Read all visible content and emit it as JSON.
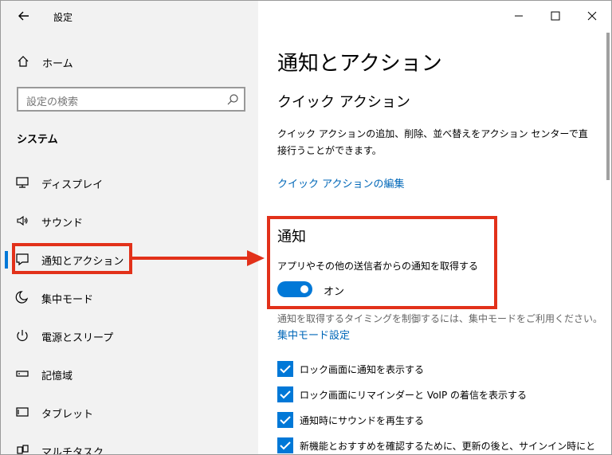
{
  "window": {
    "app_title": "設定",
    "back_icon": "back-arrow-icon",
    "controls": {
      "minimize": "—",
      "maximize": "☐",
      "close": "✕"
    }
  },
  "sidebar": {
    "home_label": "ホーム",
    "search_placeholder": "設定の検索",
    "section_label": "システム",
    "items": [
      {
        "label": "ディスプレイ",
        "icon": "monitor-icon"
      },
      {
        "label": "サウンド",
        "icon": "speaker-icon"
      },
      {
        "label": "通知とアクション",
        "icon": "notification-icon",
        "active": true
      },
      {
        "label": "集中モード",
        "icon": "moon-icon"
      },
      {
        "label": "電源とスリープ",
        "icon": "power-icon"
      },
      {
        "label": "記憶域",
        "icon": "storage-icon"
      },
      {
        "label": "タブレット",
        "icon": "tablet-icon"
      },
      {
        "label": "マルチタスク",
        "icon": "multitask-icon"
      }
    ]
  },
  "main": {
    "page_title": "通知とアクション",
    "quick_actions_title": "クイック アクション",
    "quick_actions_desc": "クイック アクションの追加、削除、並べ替えをアクション センターで直接行うことができます。",
    "quick_actions_link": "クイック アクションの編集",
    "notifications_title": "通知",
    "notifications_setting": "アプリやその他の送信者からの通知を取得する",
    "toggle_state": "オン",
    "timing_hint": "通知を取得するタイミングを制御するには、集中モードをご利用ください。",
    "focus_link": "集中モード設定",
    "checkboxes": [
      {
        "label": "ロック画面に通知を表示する",
        "checked": true
      },
      {
        "label": "ロック画面にリマインダーと VoIP の着信を表示する",
        "checked": true
      },
      {
        "label": "通知時にサウンドを再生する",
        "checked": true
      },
      {
        "label": "新機能とおすすめを確認するために、更新の後と、サインイン時にと",
        "checked": true
      }
    ]
  },
  "colors": {
    "accent": "#0078d7",
    "link": "#0067b8",
    "highlight": "#e2311a",
    "sidebar_bg": "#f2f2f2"
  }
}
